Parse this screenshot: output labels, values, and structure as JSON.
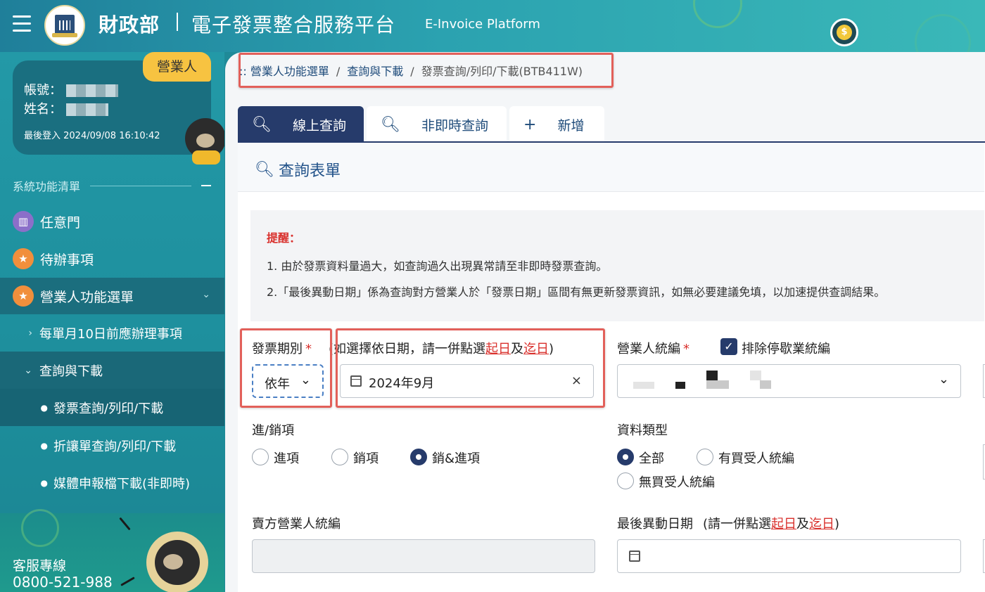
{
  "header": {
    "ministry": "財政部",
    "platform": "電子發票整合服務平台",
    "platform_en": "E-Invoice Platform"
  },
  "user": {
    "role": "營業人",
    "account_label": "帳號：",
    "name_label": "姓名：",
    "last_login": "最後登入 2024/09/08 16:10:42"
  },
  "sidebar": {
    "section_title": "系統功能清單",
    "items": [
      {
        "label": "任意門",
        "icon": "map-icon"
      },
      {
        "label": "待辦事項",
        "icon": "star-icon"
      },
      {
        "label": "營業人功能選單",
        "icon": "star-icon"
      }
    ],
    "sub_items": [
      {
        "label": "每單月10日前應辦理事項"
      },
      {
        "label": "查詢與下載"
      }
    ],
    "subsub_items": [
      {
        "label": "發票查詢/列印/下載"
      },
      {
        "label": "折讓單查詢/列印/下載"
      },
      {
        "label": "媒體申報檔下載(非即時)"
      }
    ],
    "helpline_label": "客服專線",
    "helpline_number": "0800-521-988"
  },
  "breadcrumb": {
    "prefix": "::",
    "items": [
      "營業人功能選單",
      "查詢與下載",
      "發票查詢/列印/下載(BTB411W)"
    ],
    "separator": "/"
  },
  "tabs": [
    {
      "label": "線上查詢",
      "icon": "search-icon",
      "active": true
    },
    {
      "label": "非即時查詢",
      "icon": "search-icon",
      "active": false
    },
    {
      "label": "新增",
      "icon": "plus-icon",
      "active": false
    }
  ],
  "form": {
    "title": "查詢表單",
    "notice_title": "提醒：",
    "notice_1": "1. 由於發票資料量過大，如查詢過久出現異常請至非即時發票查詢。",
    "notice_2": "2.「最後異動日期」係為查詢對方營業人於「發票日期」區間有無更新發票資訊，如無必要建議免填，以加速提供查調結果。",
    "period_label": "發票期別",
    "required_mark": "*",
    "date_hint_a": "(如選擇依日期，請一併點選",
    "date_hint_start": "起日",
    "date_hint_and": "及",
    "date_hint_end": "迄日",
    "date_hint_close": ")",
    "period_mode": "依年",
    "period_value": "2024年9月",
    "clear_mark": "×",
    "ban_label": "營業人統編",
    "exclude_label": "排除停歇業統編",
    "direction_label": "進/銷項",
    "direction_options": [
      "進項",
      "銷項",
      "銷&進項"
    ],
    "direction_selected": 2,
    "data_type_label": "資料類型",
    "data_type_options": [
      "全部",
      "有買受人統編",
      "無買受人統編"
    ],
    "data_type_selected": 0,
    "seller_ban_label": "賣方營業人統編",
    "last_change_label": "最後異動日期",
    "last_change_hint_a": "(請一併點選",
    "last_change_hint_start": "起日",
    "last_change_hint_and": "及",
    "last_change_hint_end": "迄日",
    "last_change_hint_close": ")"
  }
}
